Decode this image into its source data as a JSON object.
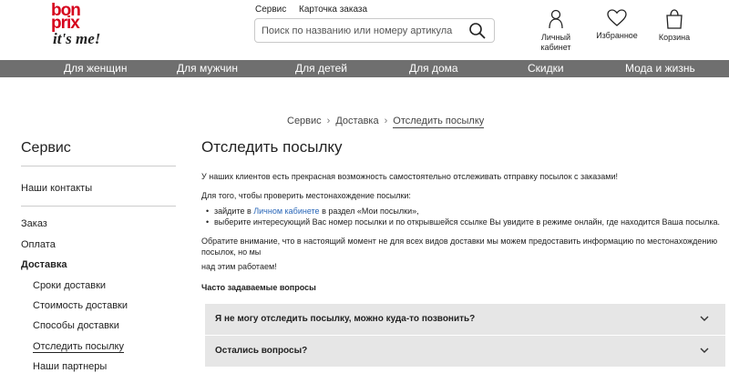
{
  "logo": {
    "line1": "bon",
    "line2": "prix",
    "line3": "it's me!"
  },
  "toplinks": [
    "Сервис",
    "Карточка заказа"
  ],
  "search": {
    "placeholder": "Поиск по названию или номеру артикула"
  },
  "header_icons": {
    "account": {
      "label_line1": "Личный",
      "label_line2": "кабинет",
      "icon": "user-icon"
    },
    "wishlist": {
      "label": "Избранное",
      "icon": "heart-icon"
    },
    "cart": {
      "label": "Корзина",
      "icon": "bag-icon"
    }
  },
  "nav": [
    "Для женщин",
    "Для мужчин",
    "Для детей",
    "Для дома",
    "Скидки",
    "Мода и жизнь"
  ],
  "breadcrumb": [
    "Сервис",
    "Доставка",
    "Отследить посылку"
  ],
  "sidebar": {
    "title": "Сервис",
    "contacts": "Наши контакты",
    "items": [
      {
        "label": "Заказ"
      },
      {
        "label": "Оплата"
      },
      {
        "label": "Доставка"
      },
      {
        "label": "Сроки доставки"
      },
      {
        "label": "Стоимость доставки"
      },
      {
        "label": "Способы доставки"
      },
      {
        "label": "Отследить посылку"
      },
      {
        "label": "Наши партнеры"
      }
    ]
  },
  "main": {
    "title": "Отследить посылку",
    "intro": "У наших клиентов есть прекрасная возможность самостоятельно отслеживать отправку посылок с заказами!",
    "check_intro": "Для того, чтобы проверить местонахождение посылки:",
    "bullet1_pre": "зайдите в ",
    "bullet1_link": "Личном кабинете",
    "bullet1_post": " в раздел «Мои посылки»,",
    "bullet2": "выберите интересующий Вас номер посылки и по открывшейся ссылке Вы увидите в режиме онлайн, где находится Ваша посылка.",
    "note_line1": "Обратите внимание, что в настоящий момент не для всех видов доставки мы можем предоставить информацию по местонахождению посылок, но мы",
    "note_line2": "над этим работаем!",
    "faq_title": "Часто задаваемые вопросы",
    "faq": [
      {
        "question": "Я не могу отследить посылку, можно куда-то позвонить?"
      },
      {
        "question": "Остались вопросы?"
      }
    ]
  },
  "colors": {
    "brand": "#d6001c",
    "nav_bg": "#6f6f6f",
    "accordion_bg": "#e6e6e6",
    "link": "#2a67b8"
  }
}
